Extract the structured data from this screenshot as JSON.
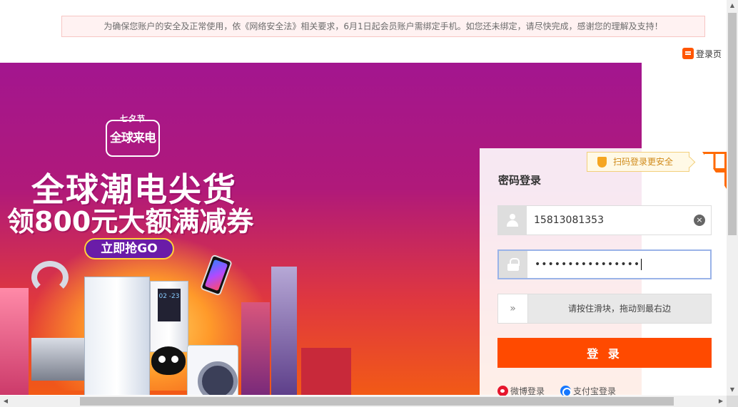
{
  "notice": {
    "text": "为确保您账户的安全及正常使用，依《网络安全法》相关要求，6月1日起会员账户需绑定手机。如您还未绑定，请尽快完成，感谢您的理解及支持！"
  },
  "feedback": {
    "icon": "feedback-icon",
    "label": "登录页"
  },
  "banner": {
    "badge_top": "七夕节",
    "badge_main": "全球来电",
    "headline_line1": "全球潮电尖货",
    "headline_line2": "领800元大额满减券",
    "cta_label": "立即抢GO",
    "ac_display": "02 -23"
  },
  "login": {
    "qr_tip": "扫码登录更安全",
    "title": "密码登录",
    "username": {
      "value": "15813081353",
      "icon": "user-icon"
    },
    "password": {
      "masked_value": "••••••••••••••••",
      "icon": "lock-icon"
    },
    "slider": {
      "handle_glyph": "»",
      "hint": "请按住滑块，拖动到最右边"
    },
    "submit_label": "登 录",
    "alt_logins": [
      {
        "label": "微博登录",
        "icon": "weibo-icon"
      },
      {
        "label": "支付宝登录",
        "icon": "alipay-icon"
      }
    ],
    "clear_glyph": "×"
  },
  "scrollbars": {
    "up": "▲",
    "down": "▼",
    "left": "◀",
    "right": "▶"
  },
  "colors": {
    "brand_orange": "#ff4a00",
    "notice_bg": "#fff2f2",
    "tip_border": "#f2cf7b"
  }
}
